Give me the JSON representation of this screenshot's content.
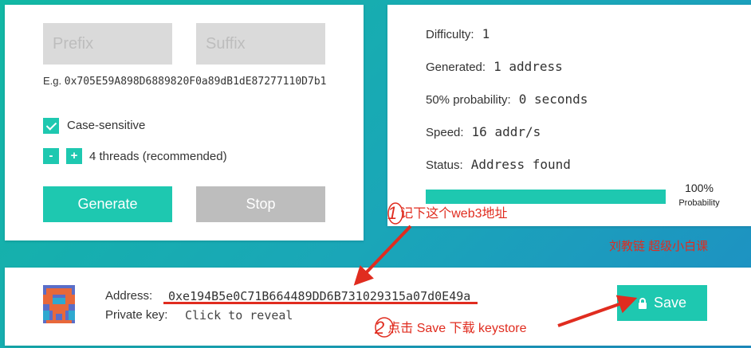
{
  "left_panel": {
    "prefix_placeholder": "Prefix",
    "suffix_placeholder": "Suffix",
    "example_label": "E.g.",
    "example_value": "0x705E59A898D6889820F0a89dB1dE87277110D7b1",
    "case_sensitive_label": "Case-sensitive",
    "case_sensitive_checked": true,
    "minus_label": "-",
    "plus_label": "+",
    "threads_label": "4 threads (recommended)",
    "generate_label": "Generate",
    "stop_label": "Stop"
  },
  "stats": {
    "difficulty_label": "Difficulty:",
    "difficulty_value": "1",
    "generated_label": "Generated:",
    "generated_value": "1 address",
    "probability_label": "50% probability:",
    "probability_value": "0 seconds",
    "speed_label": "Speed:",
    "speed_value": "16 addr/s",
    "status_label": "Status:",
    "status_value": "Address found",
    "progress_percent": 100,
    "progress_text": "100%",
    "progress_caption": "Probability"
  },
  "result": {
    "address_label": "Address:",
    "address_value": "0xe194B5e0C71B664489DD6B731029315a07d0E49a",
    "private_key_label": "Private key:",
    "private_key_value": "Click to reveal",
    "save_label": "Save",
    "save_icon": "lock-icon"
  },
  "annotations": {
    "step1_number": "1",
    "step1_text": "记下这个web3地址",
    "step2_number": "2",
    "step2_text": "点击 Save 下载 keystore",
    "watermark": "刘教链 超级小白课",
    "color": "#e02c1f"
  },
  "colors": {
    "accent": "#1ec8b0",
    "disabled": "#bdbdbd",
    "input_bg": "#dadada"
  }
}
